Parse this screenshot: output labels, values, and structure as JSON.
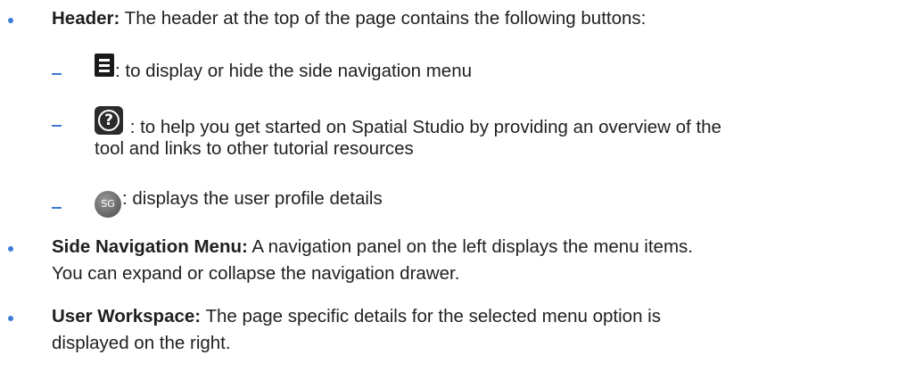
{
  "header_item": {
    "label": "Header:",
    "text": " The header at the top of the page contains the following buttons:"
  },
  "sub_items": [
    {
      "icon": "menu-icon",
      "text": ": to display or hide the side navigation menu"
    },
    {
      "icon": "help-icon",
      "icon_glyph": "?",
      "line1": " : to help you get started on Spatial Studio by providing an overview of the",
      "line2": "tool and links to other tutorial resources"
    },
    {
      "icon": "avatar-icon",
      "icon_text": "SG",
      "text": ": displays the user profile details"
    }
  ],
  "side_nav_item": {
    "label": "Side Navigation Menu:",
    "text": " A navigation panel on the left displays the menu items.",
    "line2": "You can expand or collapse the navigation drawer."
  },
  "workspace_item": {
    "label": "User Workspace:",
    "text": " The page specific details for the selected menu option is",
    "line2": "displayed on the right."
  },
  "colors": {
    "bullet": "#3d7bd5",
    "text": "#1f1f1f"
  }
}
